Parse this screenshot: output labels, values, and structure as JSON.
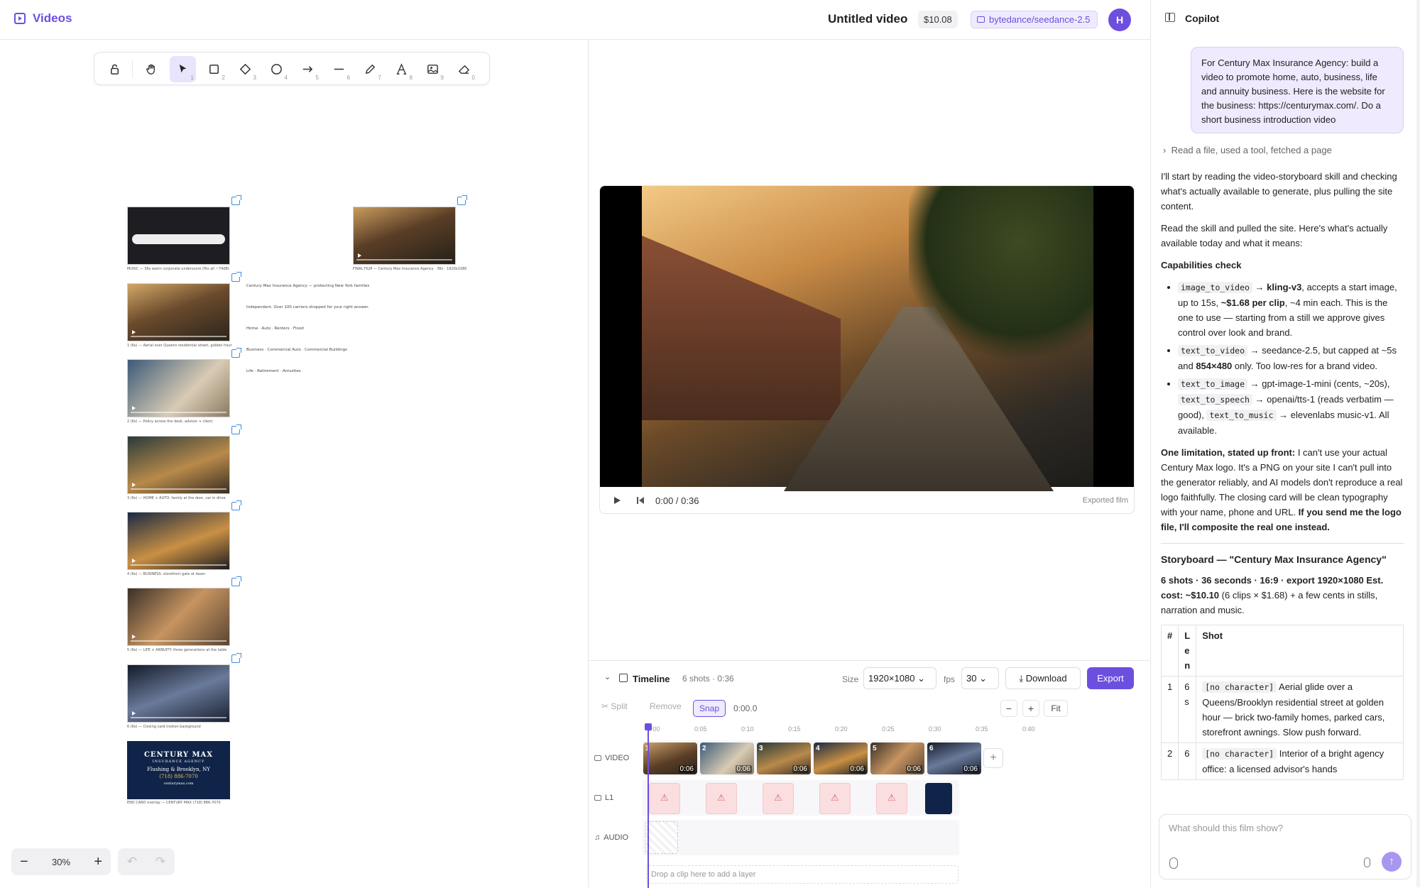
{
  "app": {
    "name": "Videos",
    "project_title": "Untitled video",
    "cost": "$10.08",
    "model": "bytedance/seedance-2.5",
    "avatar_initial": "H"
  },
  "toolbar": {
    "tools": [
      {
        "name": "lock",
        "num": ""
      },
      {
        "name": "hand",
        "num": ""
      },
      {
        "name": "select",
        "num": "1"
      },
      {
        "name": "rectangle",
        "num": "2"
      },
      {
        "name": "diamond",
        "num": "3"
      },
      {
        "name": "ellipse",
        "num": "4"
      },
      {
        "name": "arrow",
        "num": "5"
      },
      {
        "name": "line",
        "num": "6"
      },
      {
        "name": "pencil",
        "num": "7"
      },
      {
        "name": "text",
        "num": "8"
      },
      {
        "name": "image",
        "num": "9"
      },
      {
        "name": "eraser",
        "num": "0"
      }
    ]
  },
  "canvas": {
    "captions": [
      "MUSIC — 36s warm corporate underscore (fits all ~74dB)",
      "1 (6s) — Aerial over Queens residential street, golden hour",
      "2 (6s) — Policy across the desk, advisor + client",
      "3 (6s) — HOME + AUTO: family at the door, car in drive",
      "4 (6s) — BUSINESS: storefront gate at dawn",
      "5 (6s) — LIFE + ANNUITY: three generations at the table",
      "6 (6s) — Closing card motion background",
      "END CARD overlay — CENTURY MAX (718) 886-7070"
    ],
    "final_caption": "FINAL FILM — Century Max Insurance Agency · 36s · 1920x1080",
    "notes": [
      "Century Max Insurance Agency — protecting New York families",
      "Independent. Over 100 carriers shopped for your right answer.",
      "Home · Auto · Renters · Flood",
      "Business · Commercial Auto · Commercial Buildings",
      "Life · Retirement · Annuities"
    ],
    "end_card": {
      "line1": "CENTURY MAX",
      "line2": "INSURANCE AGENCY",
      "line3": "Flushing & Brooklyn, NY",
      "line4": "(718) 886-7070",
      "line5": "centurymax.com"
    },
    "zoom": "30%"
  },
  "preview": {
    "time": "0:00 / 0:36",
    "label": "Exported film"
  },
  "timeline": {
    "title": "Timeline",
    "meta": "6 shots · 0:36",
    "size_label": "Size",
    "size_value": "1920×1080",
    "fps_label": "fps",
    "fps_value": "30",
    "download": "Download",
    "export": "Export",
    "split": "Split",
    "remove": "Remove",
    "snap": "Snap",
    "timecode": "0:00.0",
    "zoom_out": "−",
    "zoom_in": "+",
    "fit": "Fit",
    "ruler": [
      "0:00",
      "0:05",
      "0:10",
      "0:15",
      "0:20",
      "0:25",
      "0:30",
      "0:35",
      "0:40"
    ],
    "tracks": {
      "video": "VIDEO",
      "layer": "L1",
      "audio": "AUDIO"
    },
    "clips": [
      {
        "n": "1",
        "d": "0:06"
      },
      {
        "n": "2",
        "d": "0:06"
      },
      {
        "n": "3",
        "d": "0:06"
      },
      {
        "n": "4",
        "d": "0:06"
      },
      {
        "n": "5",
        "d": "0:06"
      },
      {
        "n": "6",
        "d": "0:06"
      }
    ],
    "drop_hint": "Drop a clip here to add a layer"
  },
  "copilot": {
    "title": "Copilot",
    "user_message": "For Century Max Insurance Agency: build a video to promote home, auto, business, life and annuity business. Here is the website for the business: https://centurymax.com/. Do a short business introduction video",
    "tool_summary": "Read a file, used a tool, fetched a page",
    "p1": "I'll start by reading the video-storyboard skill and checking what's actually available to generate, plus pulling the site content.",
    "p2": "Read the skill and pulled the site. Here's what's actually available today and what it means:",
    "cap_heading": "Capabilities check",
    "b1_code": "image_to_video",
    "b1_model": "kling-v3",
    "b1_rest": ", accepts a start image, up to 15s, ",
    "b1_price": "~$1.68 per clip",
    "b1_tail": ", ~4 min each. This is the one to use — starting from a still we approve gives control over look and brand.",
    "b2_code": "text_to_video",
    "b2_rest": " → seedance-2.5, but capped at ~5s and ",
    "b2_res": "854×480",
    "b2_tail": " only. Too low-res for a brand video.",
    "b3_code1": "text_to_image",
    "b3_a": " → gpt-image-1-mini (cents, ~20s), ",
    "b3_code2": "text_to_speech",
    "b3_b": " → openai/tts-1 (reads verbatim — good), ",
    "b3_code3": "text_to_music",
    "b3_c": " → elevenlabs music-v1. All available.",
    "limit_bold": "One limitation, stated up front:",
    "limit_text": " I can't use your actual Century Max logo. It's a PNG on your site I can't pull into the generator reliably, and AI models don't reproduce a real logo faithfully. The closing card will be clean typography with your name, phone and URL. ",
    "limit_bold2": "If you send me the logo file, I'll composite the real one instead.",
    "storyboard_title": "Storyboard — \"Century Max Insurance Agency\"",
    "sb_summary_bold": "6 shots · 36 seconds · 16:9 · export 1920×1080 Est. cost: ~$10.10",
    "sb_summary_rest": " (6 clips × $1.68) + a few cents in stills, narration and music.",
    "table_headers": [
      "#",
      "Len",
      "Shot"
    ],
    "table_rows": [
      {
        "n": "1",
        "len": "6s",
        "tag": "[no character]",
        "shot": " Aerial glide over a Queens/Brooklyn residential street at golden hour — brick two-family homes, parked cars, storefront awnings. Slow push forward."
      },
      {
        "n": "2",
        "len": "6",
        "tag": "[no character]",
        "shot": " Interior of a bright agency office: a licensed advisor's hands"
      }
    ],
    "composer_placeholder": "What should this film show?"
  }
}
